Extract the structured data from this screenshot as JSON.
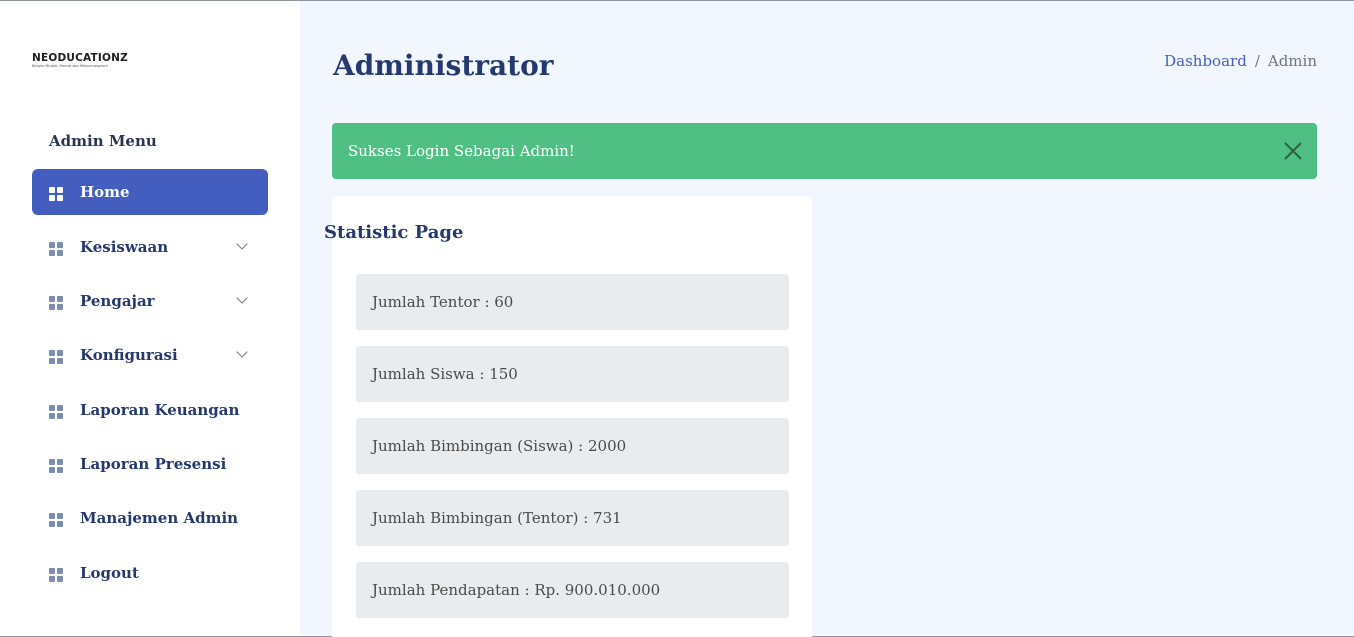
{
  "logo": {
    "text": "NEODUCATIONZ",
    "tagline": "Belajar Mudah, Hemat dan Menyenangkan!"
  },
  "sidebar": {
    "heading": "Admin Menu",
    "items": [
      {
        "label": "Home",
        "icon": "grid-icon",
        "active": true,
        "expandable": false
      },
      {
        "label": "Kesiswaan",
        "icon": "grid-icon",
        "active": false,
        "expandable": true
      },
      {
        "label": "Pengajar",
        "icon": "grid-icon",
        "active": false,
        "expandable": true
      },
      {
        "label": "Konfigurasi",
        "icon": "grid-icon",
        "active": false,
        "expandable": true
      },
      {
        "label": "Laporan Keuangan",
        "icon": "grid-icon",
        "active": false,
        "expandable": false
      },
      {
        "label": "Laporan Presensi",
        "icon": "grid-icon",
        "active": false,
        "expandable": false
      },
      {
        "label": "Manajemen Admin",
        "icon": "grid-icon",
        "active": false,
        "expandable": false
      },
      {
        "label": "Logout",
        "icon": "grid-icon",
        "active": false,
        "expandable": false
      }
    ]
  },
  "header": {
    "title": "Administrator",
    "breadcrumb": {
      "link": "Dashboard",
      "separator": "/",
      "current": "Admin"
    }
  },
  "alert": {
    "message": "Sukses Login Sebagai Admin!",
    "close_icon": "close-icon",
    "color": "#4fbf84"
  },
  "statistics": {
    "title": "Statistic Page",
    "items": [
      "Jumlah Tentor : 60",
      "Jumlah Siswa : 150",
      "Jumlah Bimbingan (Siswa) : 2000",
      "Jumlah Bimbingan (Tentor) : 731",
      "Jumlah Pendapatan : Rp. 900.010.000"
    ]
  },
  "colors": {
    "accent": "#435ebe",
    "title": "#25396f",
    "background": "#f2f7ff"
  }
}
